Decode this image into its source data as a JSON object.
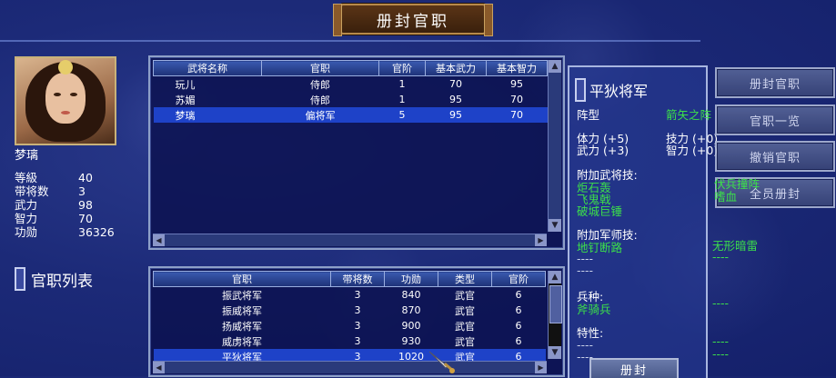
{
  "title": "册封官职",
  "character": {
    "name": "梦璃",
    "stats": [
      {
        "label": "等級",
        "value": "40"
      },
      {
        "label": "带将数",
        "value": "3"
      },
      {
        "label": "武力",
        "value": "98"
      },
      {
        "label": "智力",
        "value": "70"
      },
      {
        "label": "功勋",
        "value": "36326"
      }
    ]
  },
  "generals_table": {
    "headers": [
      "武将名称",
      "官职",
      "官阶",
      "基本武力",
      "基本智力"
    ],
    "rows": [
      {
        "name": "玩儿",
        "office": "侍郎",
        "rank": "1",
        "power": "70",
        "intel": "95"
      },
      {
        "name": "苏媚",
        "office": "侍郎",
        "rank": "1",
        "power": "95",
        "intel": "70"
      },
      {
        "name": "梦璃",
        "office": "偏将军",
        "rank": "5",
        "power": "95",
        "intel": "70",
        "selected": true
      }
    ]
  },
  "office_list_label": "官职列表",
  "offices_table": {
    "headers": [
      "官职",
      "带将数",
      "功勋",
      "类型",
      "官阶"
    ],
    "rows": [
      {
        "office": "振武将军",
        "count": "3",
        "merit": "840",
        "type": "武官",
        "rank": "6"
      },
      {
        "office": "振威将军",
        "count": "3",
        "merit": "870",
        "type": "武官",
        "rank": "6"
      },
      {
        "office": "扬威将军",
        "count": "3",
        "merit": "900",
        "type": "武官",
        "rank": "6"
      },
      {
        "office": "威虏将军",
        "count": "3",
        "merit": "930",
        "type": "武官",
        "rank": "6"
      },
      {
        "office": "平狄将军",
        "count": "3",
        "merit": "1020",
        "type": "武官",
        "rank": "6",
        "selected": true
      }
    ]
  },
  "detail": {
    "title": "平狄将军",
    "formation_label": "阵型",
    "formation_value": "箭矢之阵",
    "hp": "体力 (+5)",
    "skill": "技力 (+0)",
    "power": "武力 (+3)",
    "intel": "智力 (+0)",
    "general_skills_label": "附加武将技:",
    "general_skills": [
      "炬石轰",
      "飞鬼戟",
      "破城巨锤"
    ],
    "general_skills_right": [
      "伏兵撞阵",
      "嗜血"
    ],
    "strategist_skills_label": "附加军师技:",
    "strategist_skill_1": "地钉断路",
    "strategist_skill_2": "无形暗雷",
    "dash": "----",
    "troop_label": "兵种:",
    "troop_value": "斧骑兵",
    "trait_label": "特性:"
  },
  "buttons": {
    "appoint": "册封官职",
    "list": "官职一览",
    "revoke": "撤销官职",
    "all": "全员册封"
  },
  "confirm_button": "册封"
}
